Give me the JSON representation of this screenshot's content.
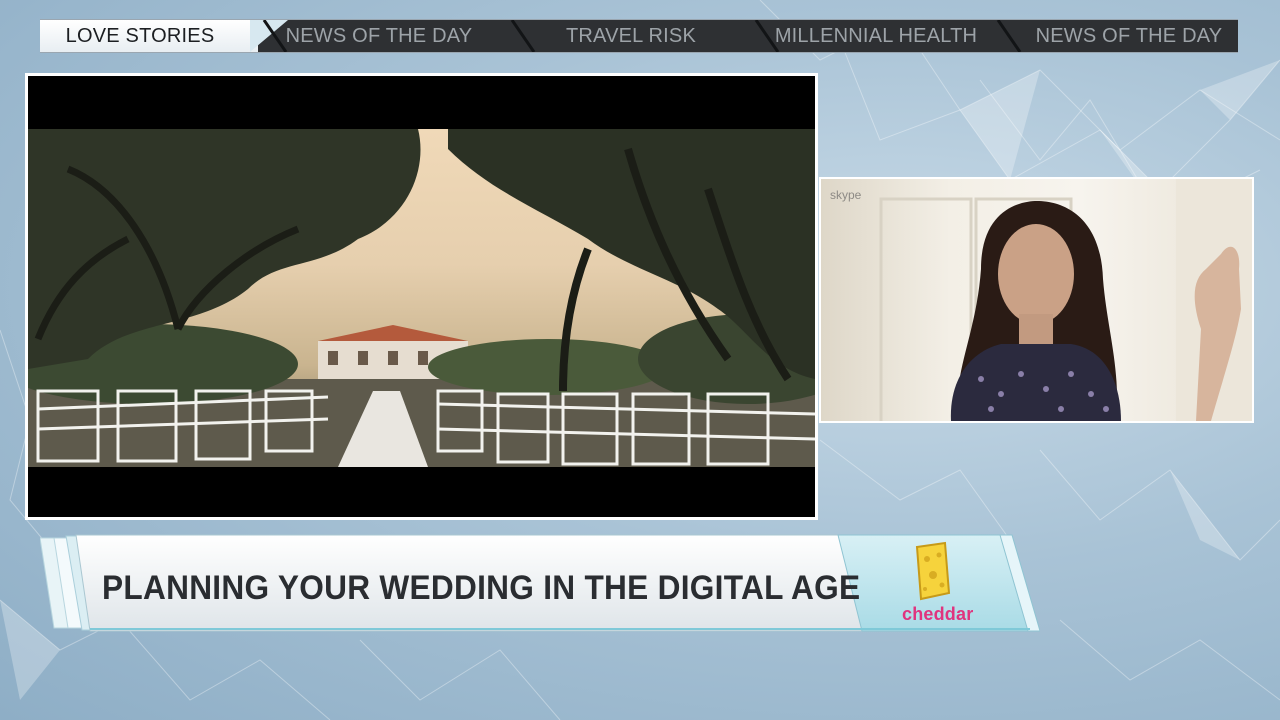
{
  "ticker": {
    "tabs": [
      {
        "label": "LOVE STORIES"
      },
      {
        "label": "NEWS OF THE DAY"
      },
      {
        "label": "TRAVEL RISK"
      },
      {
        "label": "MILLENNIAL HEALTH"
      },
      {
        "label": "NEWS OF THE DAY"
      }
    ]
  },
  "video": {
    "scene": "outdoor wedding ceremony with white chairs under oak trees"
  },
  "skype": {
    "logo_text": "skype"
  },
  "lower_third": {
    "headline": "PLANNING YOUR WEDDING IN THE DIGITAL AGE",
    "brand": "cheddar"
  },
  "colors": {
    "brand_pink": "#e0337e",
    "cheese_yellow": "#f6d33c",
    "ticker_bg": "#2e3033",
    "lower_third_bg": "#f4f6f7",
    "accent_teal": "#7fc9d8"
  }
}
